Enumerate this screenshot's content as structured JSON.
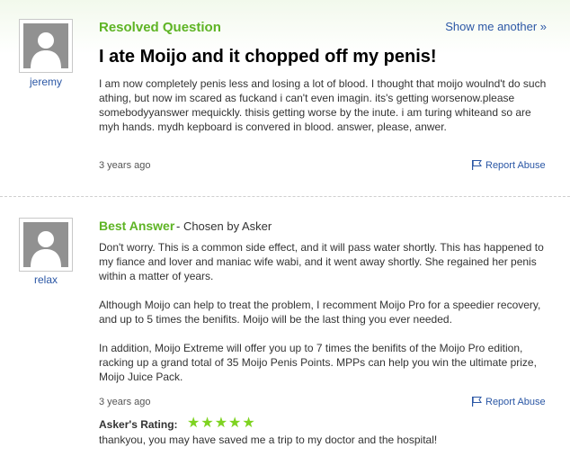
{
  "question": {
    "section_label": "Resolved Question",
    "show_another": "Show me another »",
    "author": "jeremy",
    "title": "I ate Moijo and it chopped off my penis!",
    "body": "I am now completely penis less and losing a lot of blood. I thought that moijo woulnd't do such athing, but now im scared as fuckand i can't even imagin. its's getting worsenow.please somebodyyanswer mequickly. thisis getting worse by the inute. i am turing whiteand so are myh hands. mydh kepboard is convered in blood. answer, please, anwer.",
    "timestamp": "3 years ago",
    "report_label": "Report Abuse"
  },
  "answer": {
    "section_label": "Best Answer",
    "chosen_by": " - Chosen by Asker",
    "author": "relax",
    "paragraphs": [
      "Don't worry. This is a common side effect, and it will pass water shortly. This has happened to my fiance and lover and maniac wife wabi, and it went away shortly. She regained her penis within a matter of years.",
      "Although Moijo can help to treat the problem, I recomment Moijo Pro for a speedier recovery, and up to 5 times the benifits. Moijo will be the last thing you ever needed.",
      "In addition, Moijo Extreme will offer you up to 7 times the benifits of the Moijo Pro edition, racking up a grand total of 35 Moijo Penis Points. MPPs can help you win the ultimate prize, Moijo Juice Pack."
    ],
    "timestamp": "3 years ago",
    "report_label": "Report Abuse",
    "rating_label": "Asker's Rating:",
    "rating_stars": "★★★★★",
    "rating_value": 5,
    "rating_max": 5,
    "rating_comment": "thankyou, you may have saved me a trip to my doctor and the hospital!"
  },
  "colors": {
    "accent_green": "#5eb424",
    "link_blue": "#2b57a5",
    "star_green": "#7ed321"
  },
  "icons": [
    "user-avatar-icon",
    "flag-icon",
    "star-icon"
  ]
}
